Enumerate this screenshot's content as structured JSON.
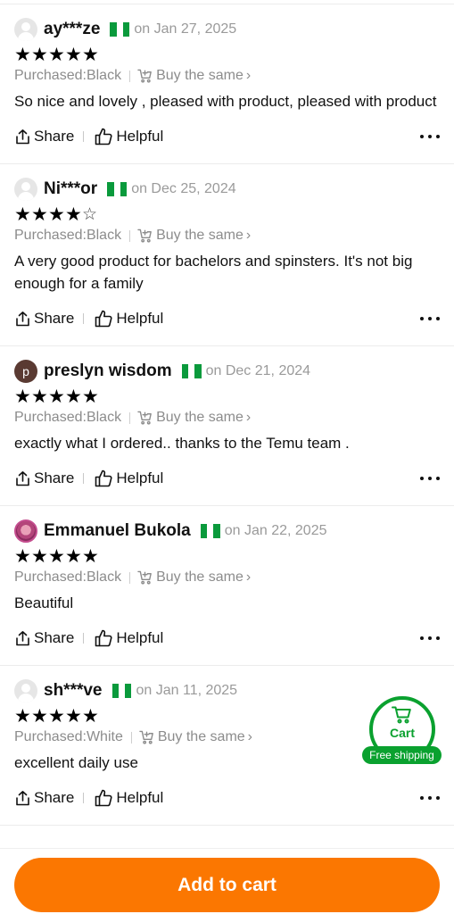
{
  "reviews": [
    {
      "username": "ay***ze",
      "avatar_type": "generic",
      "avatar_letter": "",
      "country_flag": "nigeria-flag",
      "date": "on Jan 27, 2025",
      "rating": 5,
      "purchased": "Purchased:Black",
      "buy_same_label": "Buy the same",
      "text": "So nice and lovely , pleased with product, pleased with product",
      "share_label": "Share",
      "helpful_label": "Helpful"
    },
    {
      "username": "Ni***or",
      "avatar_type": "generic",
      "avatar_letter": "",
      "country_flag": "nigeria-flag",
      "date": "on Dec 25, 2024",
      "rating": 4,
      "purchased": "Purchased:Black",
      "buy_same_label": "Buy the same",
      "text": "A very good product for bachelors and spinsters. It's not big enough for a family",
      "share_label": "Share",
      "helpful_label": "Helpful"
    },
    {
      "username": "preslyn wisdom",
      "avatar_type": "letter",
      "avatar_letter": "p",
      "country_flag": "nigeria-flag",
      "date": "on Dec 21, 2024",
      "rating": 5,
      "purchased": "Purchased:Black",
      "buy_same_label": "Buy the same",
      "text": "exactly what I ordered.. thanks to the Temu team .",
      "share_label": "Share",
      "helpful_label": "Helpful"
    },
    {
      "username": "Emmanuel Bukola",
      "avatar_type": "photo",
      "avatar_letter": "",
      "country_flag": "nigeria-flag",
      "date": "on Jan 22, 2025",
      "rating": 5,
      "purchased": "Purchased:Black",
      "buy_same_label": "Buy the same",
      "text": "Beautiful",
      "share_label": "Share",
      "helpful_label": "Helpful"
    },
    {
      "username": "sh***ve",
      "avatar_type": "generic",
      "avatar_letter": "",
      "country_flag": "nigeria-flag",
      "date": "on Jan 11, 2025",
      "rating": 5,
      "purchased": "Purchased:White",
      "buy_same_label": "Buy the same",
      "text": "excellent daily use",
      "share_label": "Share",
      "helpful_label": "Helpful"
    }
  ],
  "floating_cart": {
    "label": "Cart",
    "badge": "Free shipping",
    "icon": "cart-icon",
    "accent_color": "#0aa12f"
  },
  "bottom_bar": {
    "add_to_cart_label": "Add to cart",
    "button_color": "#fb7701"
  }
}
